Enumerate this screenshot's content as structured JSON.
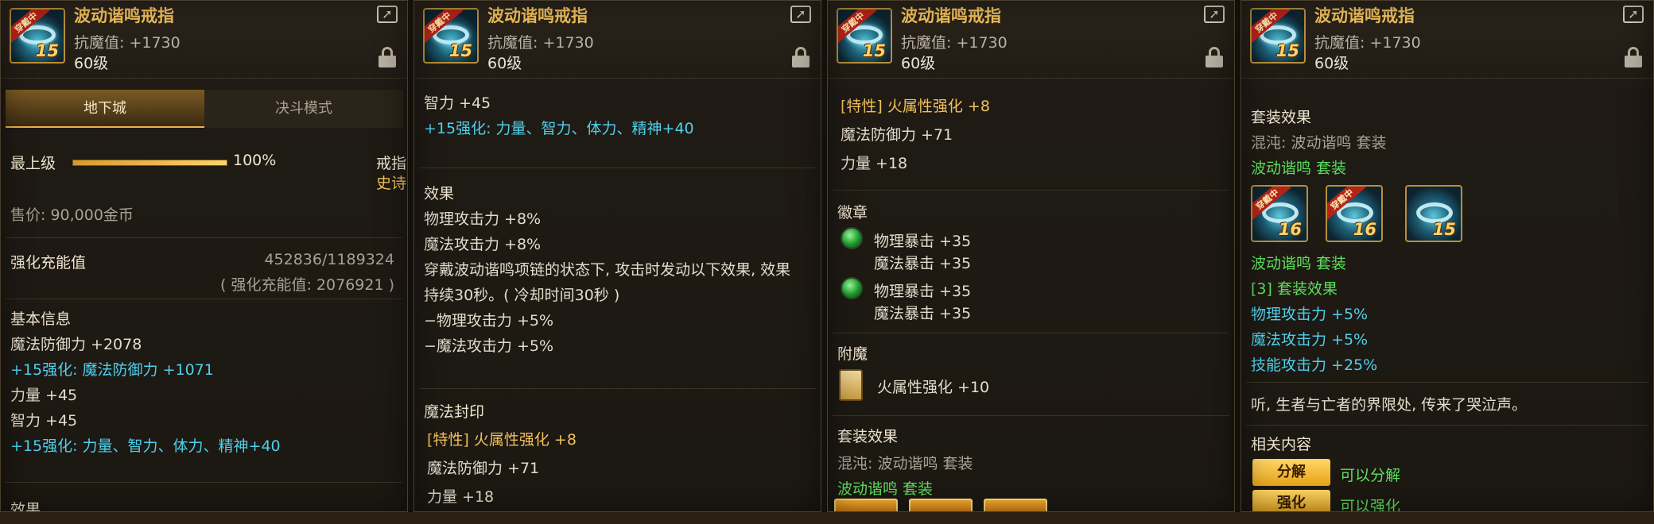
{
  "item": {
    "name": "波动谐鸣戒指",
    "anti_magic": "抗魔值: +1730",
    "level": "60级",
    "enhance_level": "15",
    "wear_badge": "穿戴中"
  },
  "panel1": {
    "tabs": [
      "地下城",
      "决斗模式"
    ],
    "grade_label": "最上级",
    "grade_percent": "100%",
    "grade_fill": 1.0,
    "slot": "戒指",
    "rarity": "史诗",
    "price": "售价: 90,000金币",
    "charge_label": "强化充能值",
    "charge_value": "452836/1189324",
    "charge_sub": "( 强化充能值: 2076921 )",
    "basic_title": "基本信息",
    "basic_lines": [
      {
        "text": "魔法防御力 +2078",
        "color": "normal"
      },
      {
        "text": "+15强化: 魔法防御力 +1071",
        "color": "cyan"
      },
      {
        "text": "力量 +45",
        "color": "normal"
      },
      {
        "text": "智力 +45",
        "color": "normal"
      },
      {
        "text": "+15强化: 力量、智力、体力、精神+40",
        "color": "cyan"
      }
    ],
    "cut_heading": "效果"
  },
  "panel2": {
    "top_lines": [
      {
        "text": "智力 +45",
        "color": "normal"
      },
      {
        "text": "+15强化: 力量、智力、体力、精神+40",
        "color": "cyan"
      }
    ],
    "effect_title": "效果",
    "effect_lines": [
      "物理攻击力 +8%",
      "魔法攻击力 +8%",
      "穿戴波动谐鸣项链的状态下, 攻击时发动以下效果, 效果",
      "持续30秒。( 冷却时间30秒 )",
      "−物理攻击力 +5%",
      "−魔法攻击力 +5%"
    ],
    "seal_title": "魔法封印",
    "seal_lines": [
      {
        "text": "[特性] 火属性强化 +8",
        "color": "gold"
      },
      {
        "text": "魔法防御力 +71",
        "color": "normal"
      },
      {
        "text": "力量 +18",
        "color": "normal"
      }
    ]
  },
  "panel3": {
    "seal_lines": [
      {
        "text": "[特性] 火属性强化 +8",
        "color": "gold"
      },
      {
        "text": "魔法防御力 +71",
        "color": "normal"
      },
      {
        "text": "力量 +18",
        "color": "normal"
      }
    ],
    "emblem_title": "徽章",
    "emblems": [
      {
        "a": "物理暴击 +35",
        "b": "魔法暴击 +35"
      },
      {
        "a": "物理暴击 +35",
        "b": "魔法暴击 +35"
      }
    ],
    "enchant_title": "附魔",
    "enchant_text": "火属性强化 +10",
    "set_title": "套装效果",
    "set_name": "混沌: 波动谐鸣 套装",
    "set_sub": "波动谐鸣  套装"
  },
  "panel4": {
    "set_title": "套装效果",
    "set_name": "混沌: 波动谐鸣 套装",
    "set_sub": "波动谐鸣  套装",
    "set_icons": [
      {
        "lvl": "16",
        "wear": "穿戴中"
      },
      {
        "lvl": "16",
        "wear": "穿戴中"
      },
      {
        "lvl": "15",
        "wear": ""
      }
    ],
    "set_sub2": "波动谐鸣  套装",
    "set_bonus_title": "[3] 套装效果",
    "set_bonus_lines": [
      "物理攻击力 +5%",
      "魔法攻击力 +5%",
      "技能攻击力 +25%"
    ],
    "flavor": "听, 生者与亡者的界限处, 传来了哭泣声。",
    "related_title": "相关内容",
    "actions": [
      {
        "button": "分解",
        "status": "可以分解"
      },
      {
        "button": "强化",
        "status": "可以强化"
      }
    ]
  }
}
